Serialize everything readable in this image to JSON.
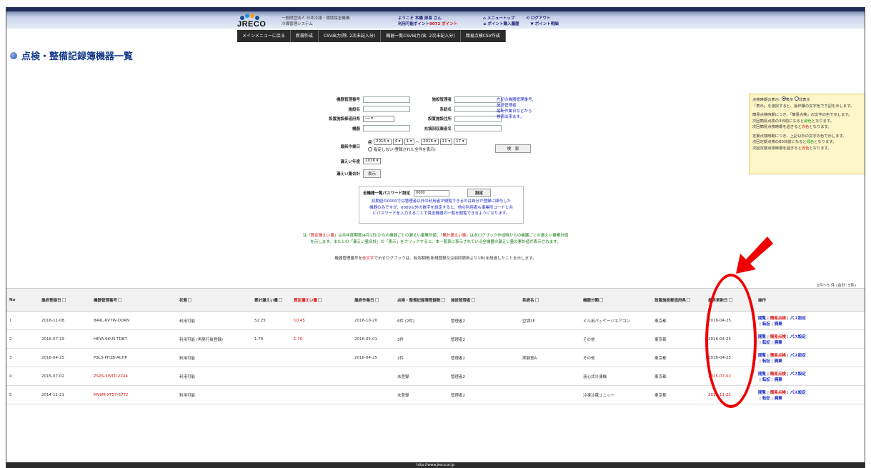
{
  "header": {
    "brand": "JRECO",
    "org_line1": "一般財団法人 日本冷媒・環境保全機構",
    "org_line2": "冷媒管理システム",
    "welcome_line1": "ようこそ 本橋 部長 さん",
    "welcome_pts_label": "利用可能ポイント",
    "welcome_pts_value": "9072 ポイント",
    "link_top": "メニュートップ",
    "link_logout": "ログアウト",
    "link_points": "ポイント購入履歴",
    "link_point_use": "ポイント明細"
  },
  "menu": [
    "メインメニューに戻る",
    "新規作成",
    "CSV出力(除. 2次未記入分)",
    "機器一覧CSV出力(含. 2次未記入分)",
    "簡易点検CSV作成"
  ],
  "page_title": "点検・整備記録簿機器一覧",
  "search": {
    "mgmt_no": "機器管理番号",
    "facility_mgr": "施設管理者",
    "facility_name": "施設名",
    "system_name": "系統名",
    "pref": "設置施設都道府県",
    "pref_value": "──",
    "address": "設置施設住所",
    "model": "機器",
    "vendor": "充填回収業者名",
    "last_work": "最新作業日",
    "y1": "2016",
    "m1": "4",
    "d1": "1",
    "tilde": "～",
    "y2": "2016",
    "m2": "11",
    "d2": "17",
    "no_spec": "指定しない(登録された全件を表示)",
    "search_btn": "検　索",
    "leak_year": "漏えい年度",
    "leak_year_value": "2016",
    "leak_total": "漏えい量合計",
    "show_btn": "表示",
    "note": [
      "左記の機器管理番号、",
      "施設管理者、",
      "最新作業日などから",
      "検索出来ます。"
    ]
  },
  "password": {
    "label": "全機器一覧パスワード設定",
    "value": "0000",
    "btn": "設定",
    "text": [
      "初期値の0000では管理者以外の利用者が閲覧できるのは自分が登録に関与した",
      "機器のみですが、0000以外の数字を設定すると、他の利用者も事業所コードと共",
      "にパスワードを入力することで貴全機器の一覧を閲覧できるようになります。"
    ]
  },
  "notice": {
    "n1a": "注「",
    "n1b": "算定漏えい量",
    "n1c": "」は本年度期首(4月1日)からの機器ごとの漏えい量累計値、「",
    "n1d": "累計漏えい量",
    "n1e": "」は本ログブック作成時からの機器ごとの漏えい量累計値",
    "n2": "を示します。またとの「漏えい量合計」の「表示」をクリックすると、本一覧表に表示されている全機器の漏えい量の累計値が表示されます。",
    "n3a": "機器管理番号を",
    "n3b": "赤文字",
    "n3c": "で示すログブックは、有効期間(新規登録又は前回更新より1年)を経過したことを示します。"
  },
  "legend": {
    "l1": "点検時期の表示:",
    "opt_show": "表示",
    "opt_hide": "非表示",
    "l2": "「表示」を選択すると、操作欄の文字色で下記を示します。",
    "l3": "簡易点検時期につき、「簡易点検」の文字の色で示します。",
    "l4a": "次回簡易点検の3日前になると",
    "l4b": "緑色",
    "l4c": "となります。",
    "l5a": "次回簡易点検時期を過ぎると",
    "l5b": "赤色",
    "l5c": "となります。",
    "l6": "定期点検時期につき、上記以外の文字の色で示します。",
    "l7a": "次回定期点検の60日前になると",
    "l7b": "緑色",
    "l7c": "となります。",
    "l8a": "次回定期点検時期を過ぎると",
    "l8b": "赤色",
    "l8c": "となります。"
  },
  "count": "1件～5 件 (合計: 5件)",
  "table": {
    "headers": [
      "No",
      "最終登録日",
      "機器管理番号",
      "状態",
      "累計漏えい量",
      "算定漏えい量",
      "最終作業日",
      "点検・整備記録簿登録数",
      "施設管理者",
      "系統名",
      "機器分類",
      "設置施設都道府県",
      "最終更新日",
      "操作"
    ],
    "rows": [
      [
        "1",
        "2016-11-08",
        "84RL-6V7W-DDRN",
        "利用可能",
        "52.25",
        "10.45",
        "2016-10-20",
        "6件 (2件)",
        "管理者2",
        "空調1F",
        "ビル用パッケージエアコン",
        "東京都",
        "2016-04-25"
      ],
      [
        "2",
        "2016-07-19",
        "HEYA-9KU5-TDB7",
        "利用可能 (再発行後登録)",
        "1.70",
        "1.70",
        "2016-05-01",
        "3件",
        "管理者2",
        "",
        "その他",
        "東京都",
        "2016-04-25"
      ],
      [
        "3",
        "2016-04-25",
        "P3LS-PH3B-ACHP",
        "利用可能",
        "",
        "",
        "2016-04-25",
        "2件",
        "管理者2",
        "実験室A",
        "その他",
        "東京都",
        "2016-04-25"
      ],
      [
        "4",
        "2015-07-02",
        "ZS2S-5WTP-2Z44",
        "利用可能",
        "",
        "",
        "",
        "未登録",
        "管理者2",
        "",
        "遠心式冷凍機",
        "東京都",
        "2015-07-02"
      ],
      [
        "5",
        "2014-11-21",
        "MV0M-XT57-67T2",
        "利用可能",
        "",
        "",
        "",
        "未登録",
        "管理者2",
        "",
        "冷凍冷蔵ユニット",
        "東京都",
        "2014-11-21"
      ]
    ],
    "ops_view": "閲覧",
    "ops_simple": "簡易点検",
    "ops_pass": "パス設定",
    "ops_transfer": "転記",
    "ops_discard": "廃棄",
    "sep": "|"
  },
  "footer": "http://www.jreco.or.jp",
  "colors": {
    "accent_red": "#dd1111",
    "link_blue": "#1a28c8",
    "menu_dark": "#2b2b2b"
  }
}
